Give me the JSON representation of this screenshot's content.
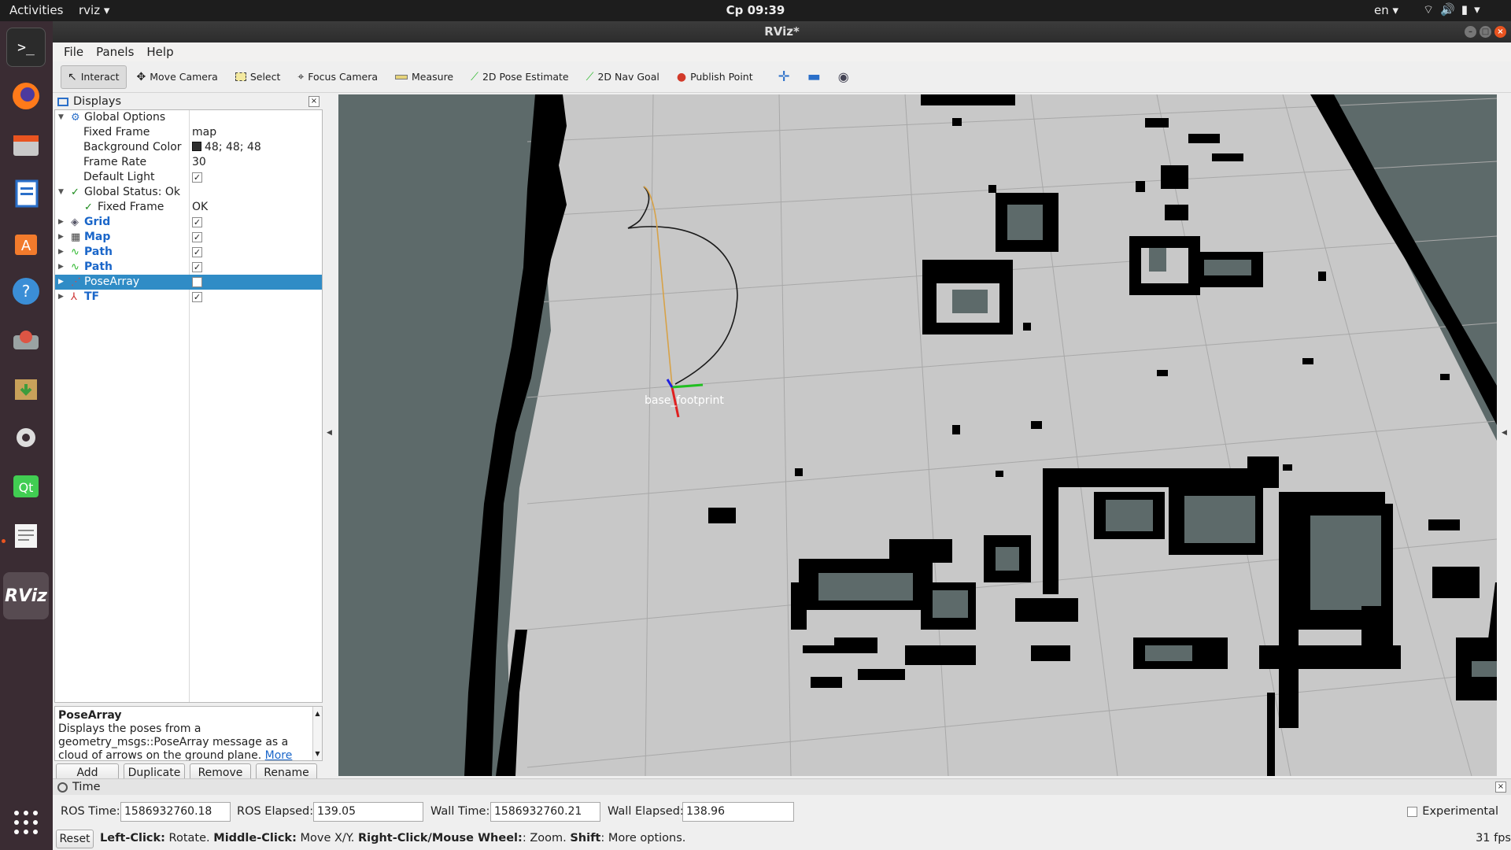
{
  "topbar": {
    "activities": "Activities",
    "app": "rviz ▾",
    "clock": "Ср 09:39",
    "lang": "en ▾"
  },
  "window": {
    "title": "RViz*"
  },
  "menu": [
    "File",
    "Panels",
    "Help"
  ],
  "toolbar": {
    "interact": "Interact",
    "move_camera": "Move Camera",
    "select": "Select",
    "focus_camera": "Focus Camera",
    "measure": "Measure",
    "pose_estimate": "2D Pose Estimate",
    "nav_goal": "2D Nav Goal",
    "publish_point": "Publish Point"
  },
  "displays": {
    "title": "Displays",
    "global_options": "Global Options",
    "fixed_frame_label": "Fixed Frame",
    "fixed_frame_value": "map",
    "bg_color_label": "Background Color",
    "bg_color_value": "48; 48; 48",
    "bg_color_hex": "#303030",
    "frame_rate_label": "Frame Rate",
    "frame_rate_value": "30",
    "default_light_label": "Default Light",
    "global_status": "Global Status: Ok",
    "status_fixed_frame": "Fixed Frame",
    "status_fixed_frame_value": "OK",
    "grid": "Grid",
    "map": "Map",
    "path1": "Path",
    "path2": "Path",
    "pose_array": "PoseArray",
    "tf": "TF",
    "desc_title": "PoseArray",
    "desc_text": "Displays the poses from a geometry_msgs::PoseArray message as a cloud of arrows on the ground plane.",
    "desc_more": "More",
    "btn_add": "Add",
    "btn_duplicate": "Duplicate",
    "btn_remove": "Remove",
    "btn_rename": "Rename"
  },
  "view": {
    "frame_label": "base_footprint"
  },
  "time": {
    "title": "Time",
    "ros_time_label": "ROS Time:",
    "ros_time": "1586932760.18",
    "ros_elapsed_label": "ROS Elapsed:",
    "ros_elapsed": "139.05",
    "wall_time_label": "Wall Time:",
    "wall_time": "1586932760.21",
    "wall_elapsed_label": "Wall Elapsed:",
    "wall_elapsed": "138.96",
    "experimental": "Experimental"
  },
  "status": {
    "reset": "Reset",
    "left_click": "Left-Click:",
    "left_desc": " Rotate.",
    "middle_click": "Middle-Click:",
    "middle_desc": " Move X/Y.",
    "right_click": "Right-Click/Mouse Wheel:",
    "right_desc": ": Zoom.",
    "shift": "Shift",
    "shift_desc": ": More options.",
    "fps": "31 fps"
  },
  "colors": {
    "accent": "#308cc6",
    "map_free": "#c8c8c8",
    "map_occupied": "#000000",
    "map_unknown": "#5d6a6a",
    "path_yellow": "#d7a248",
    "path_black": "#1a1a1a",
    "axis_x": "#e02020",
    "axis_y": "#20c020",
    "axis_z": "#2020e0"
  }
}
